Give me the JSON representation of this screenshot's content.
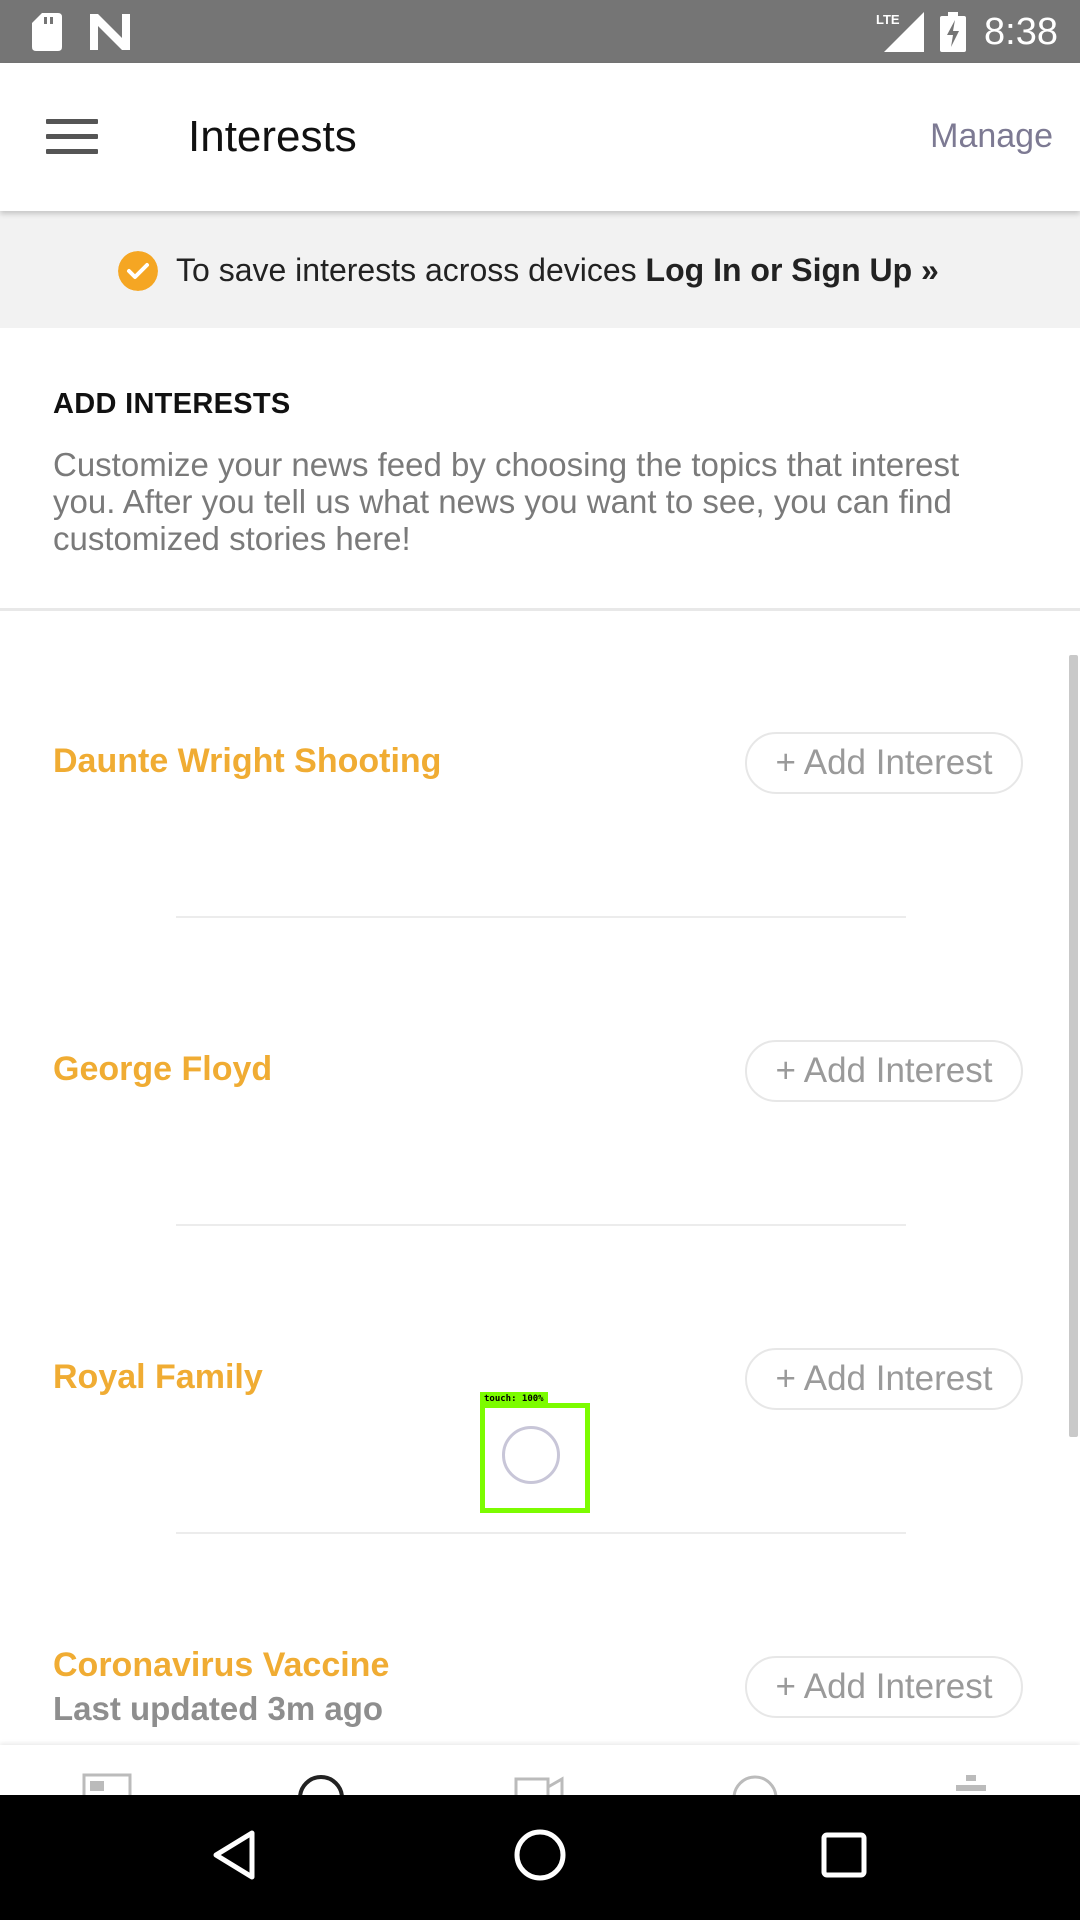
{
  "status_bar": {
    "time": "8:38",
    "network": "LTE",
    "icons": [
      "sd-card-icon",
      "n-logo-icon",
      "lte-signal-icon",
      "battery-charging-icon"
    ]
  },
  "app_bar": {
    "title": "Interests",
    "manage_label": "Manage",
    "menu_icon": "hamburger-menu-icon"
  },
  "banner": {
    "message": "To save interests across devices",
    "link": "Log In or Sign Up »",
    "icon": "check-circle-icon",
    "icon_color": "#f5a623"
  },
  "add_interests": {
    "heading": "ADD INTERESTS",
    "description": "Customize your news feed by choosing the topics that interest you. After you tell us what news you want to see, you can find customized stories here!"
  },
  "topics": [
    {
      "name": "Daunte Wright Shooting",
      "button": "+ Add Interest"
    },
    {
      "name": "George Floyd",
      "button": "+ Add Interest"
    },
    {
      "name": "Royal Family",
      "button": "+ Add Interest"
    },
    {
      "name": "Coronavirus Vaccine",
      "subtitle": "Last updated 3m ago",
      "button": "+ Add Interest"
    }
  ],
  "touch_overlay": {
    "label": "touch: 100%"
  },
  "colors": {
    "accent": "#f0ac33",
    "manage": "#7d7a93",
    "status_bar": "#757575"
  }
}
